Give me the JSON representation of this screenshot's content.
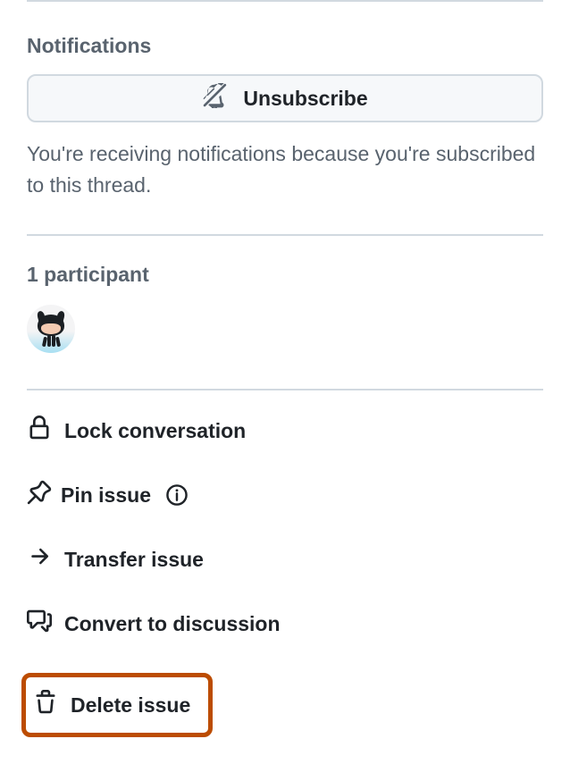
{
  "notifications": {
    "title": "Notifications",
    "unsubscribe_label": "Unsubscribe",
    "description": "You're receiving notifications because you're subscribed to this thread."
  },
  "participants": {
    "title": "1 participant"
  },
  "actions": {
    "lock_label": "Lock conversation",
    "pin_label": "Pin issue",
    "transfer_label": "Transfer issue",
    "convert_label": "Convert to discussion",
    "delete_label": "Delete issue"
  }
}
